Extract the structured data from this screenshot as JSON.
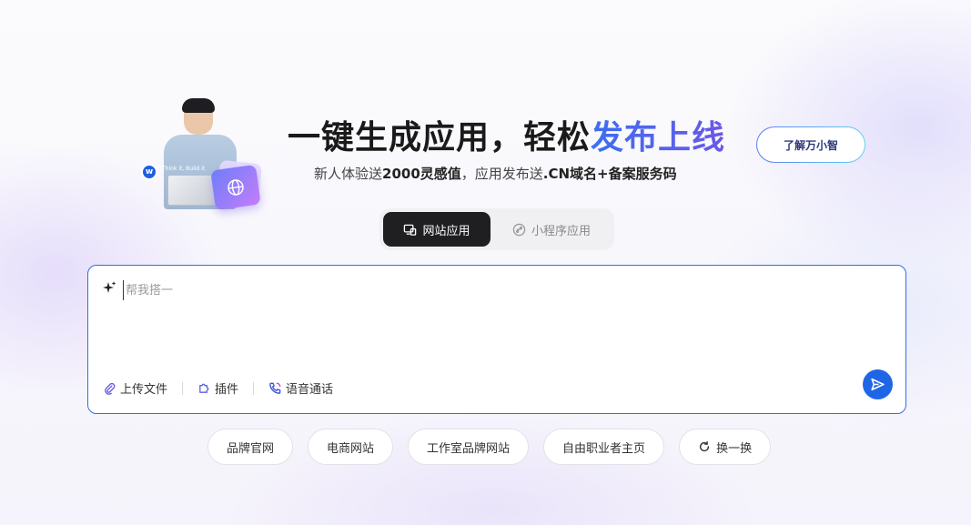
{
  "hero": {
    "title_main": "一键生成应用，轻松",
    "title_accent": "发布上线",
    "subtitle_prefix": "新人体验送",
    "subtitle_bold1": "2000灵感值",
    "subtitle_mid": "，应用发布送",
    "subtitle_bold2": ".CN域名+备案服务码",
    "laptop_caption": "Think it, Build it.",
    "learn_button": "了解万小智"
  },
  "tabs": [
    {
      "label": "网站应用",
      "icon": "website-icon",
      "active": true
    },
    {
      "label": "小程序应用",
      "icon": "miniprogram-icon",
      "active": false
    }
  ],
  "prompt": {
    "placeholder": "帮我搭一",
    "tools": [
      {
        "label": "上传文件",
        "icon": "paperclip-icon"
      },
      {
        "label": "插件",
        "icon": "plugin-icon"
      },
      {
        "label": "语音通话",
        "icon": "phone-icon"
      }
    ]
  },
  "suggestions": [
    "品牌官网",
    "电商网站",
    "工作室品牌网站",
    "自由职业者主页"
  ],
  "refresh_label": "换一换",
  "colors": {
    "accent_blue": "#1f66e6",
    "tab_active_bg": "#1f1f22",
    "title_gradient_start": "#3d6ef0",
    "title_gradient_end": "#6b58e8"
  }
}
